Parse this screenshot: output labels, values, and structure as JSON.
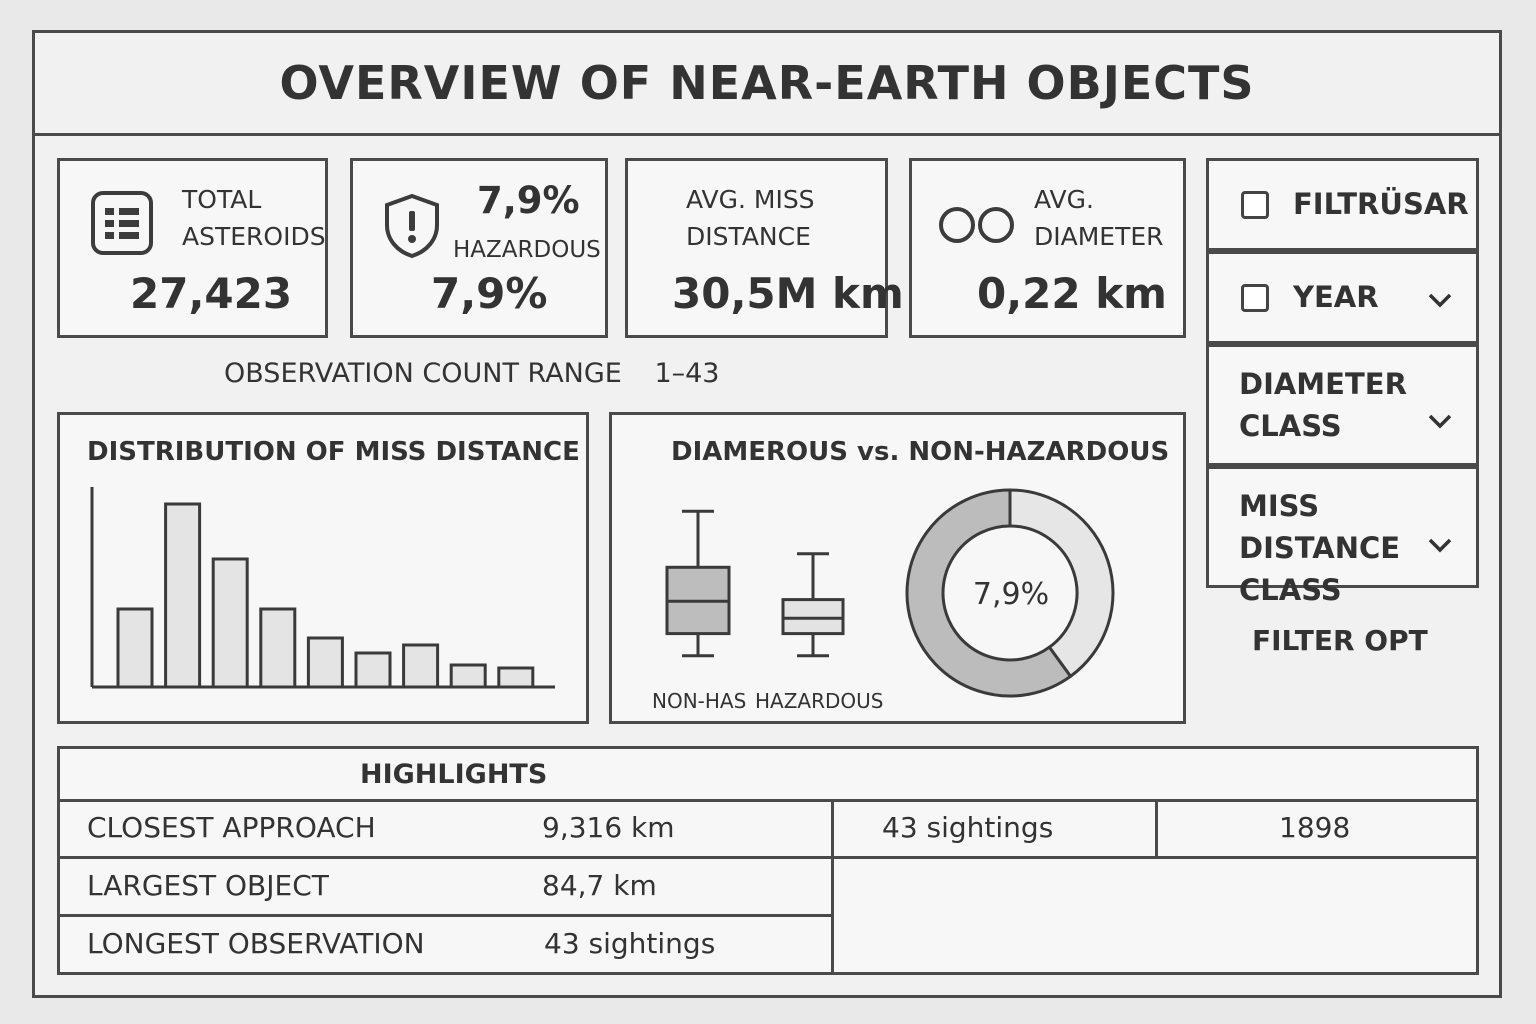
{
  "title": "OVERVIEW OF NEAR-EARTH OBJECTS",
  "kpis": {
    "total": {
      "icon": "grid-list-icon",
      "label_line1": "TOTAL",
      "label_line2": "ASTEROIDS",
      "value": "27,423"
    },
    "hazardous": {
      "icon": "shield-alert-icon",
      "top_value": "7,9%",
      "label": "HAZARDOUS",
      "value": "7,9%"
    },
    "miss": {
      "label_line1": "AVG. MISS",
      "label_line2": "DISTANCE",
      "value": "30,5M km"
    },
    "diameter": {
      "icon": "double-circle-icon",
      "label_line1": "AVG.",
      "label_line2": "DIAMETER",
      "value": "0,22 km"
    }
  },
  "filters": {
    "filter": {
      "label": "FILTRÜSAR"
    },
    "year": {
      "label": "YEAR"
    },
    "diameter_class": {
      "label_line1": "DIAMETER",
      "label_line2": "CLASS"
    },
    "miss_class": {
      "label_line1": "MISS DISTANCE",
      "label_line2": "CLASS"
    },
    "footer": "FILTER OPT"
  },
  "observation": {
    "label": "OBSERVATION COUNT RANGE",
    "value": "1–43"
  },
  "histogram": {
    "title": "DISTRIBUTION OF MISS DISTANCE"
  },
  "comparison": {
    "title": "DIAMEROUS vs. NON-HAZARDOUS",
    "donut_label": "7,9%",
    "box_labels": [
      "NON-HAS",
      "HAZARDOUS"
    ]
  },
  "chart_data": [
    {
      "type": "bar",
      "title": "DISTRIBUTION OF MISS DISTANCE",
      "values": [
        78,
        183,
        128,
        78,
        49,
        34,
        42,
        22,
        19
      ],
      "ylim": [
        0,
        200
      ]
    },
    {
      "type": "box",
      "categories": [
        "NON-HAS",
        "HAZARDOUS"
      ],
      "series": [
        {
          "name": "NON-HAS",
          "min": 18,
          "q1": 44,
          "median": 82,
          "q3": 122,
          "max": 188,
          "color": "#bdbdbd"
        },
        {
          "name": "HAZARDOUS",
          "min": 18,
          "q1": 44,
          "median": 62,
          "q3": 84,
          "max": 138,
          "color": "#e3e3e3"
        }
      ],
      "ylim": [
        0,
        200
      ]
    },
    {
      "type": "pie",
      "donut": true,
      "center_label": "7,9%",
      "slices": [
        {
          "value": 40,
          "color": "#e6e6e6"
        },
        {
          "value": 60,
          "color": "#bcbcbc"
        }
      ]
    }
  ],
  "highlights": {
    "title": "HIGHLIGHTS",
    "rows": [
      {
        "label": "CLOSEST APPROACH",
        "value": "9,316 km"
      },
      {
        "label": "LARGEST OBJECT",
        "value": "84,7 km"
      },
      {
        "label": "LONGEST OBSERVATION",
        "value": "43 sightings"
      }
    ],
    "extra": {
      "sightings": "43 sightings",
      "year": "1898"
    }
  }
}
